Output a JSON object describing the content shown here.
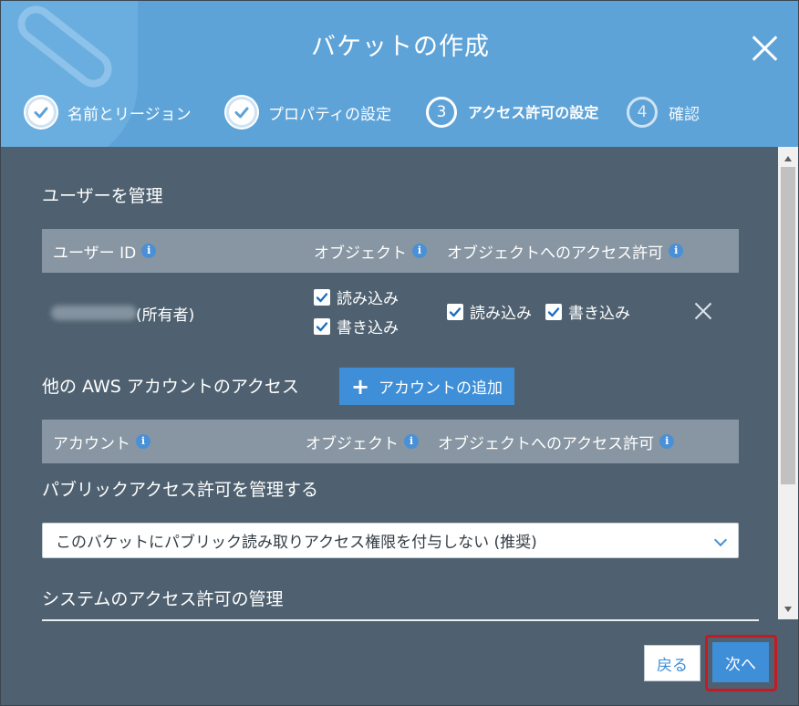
{
  "dialog": {
    "title": "バケットの作成",
    "steps": [
      {
        "label": "名前とリージョン",
        "state": "done"
      },
      {
        "label": "プロパティの設定",
        "state": "done"
      },
      {
        "number": "3",
        "label": "アクセス許可の設定",
        "state": "current"
      },
      {
        "number": "4",
        "label": "確認",
        "state": "future"
      }
    ]
  },
  "manage_users": {
    "heading": "ユーザーを管理",
    "columns": {
      "user_id": "ユーザー ID",
      "object": "オブジェクト",
      "object_permissions": "オブジェクトへのアクセス許可"
    },
    "owner_row": {
      "owner_suffix": "(所有者)",
      "object_read": {
        "label": "読み込み",
        "checked": true
      },
      "object_write": {
        "label": "書き込み",
        "checked": true
      },
      "perm_read": {
        "label": "読み込み",
        "checked": true
      },
      "perm_write": {
        "label": "書き込み",
        "checked": true
      }
    }
  },
  "other_accounts": {
    "heading": "他の AWS アカウントのアクセス",
    "add_button": "アカウントの追加",
    "columns": {
      "account": "アカウント",
      "object": "オブジェクト",
      "object_permissions": "オブジェクトへのアクセス許可"
    }
  },
  "public_access": {
    "heading": "パブリックアクセス許可を管理する",
    "selected": "このバケットにパブリック読み取りアクセス権限を付与しない (推奨)"
  },
  "system_access": {
    "heading": "システムのアクセス許可の管理"
  },
  "footer": {
    "back_label": "戻る",
    "next_label": "次へ"
  },
  "icons": {
    "info": "info-icon",
    "close": "close-icon",
    "check": "check-icon",
    "plus": "plus-icon",
    "chevron": "chevron-down-icon"
  },
  "colors": {
    "header_bg": "#5ea3d8",
    "panel_bg": "#4f6170",
    "accent": "#3f8ed8",
    "highlight_border": "#c41a24"
  }
}
